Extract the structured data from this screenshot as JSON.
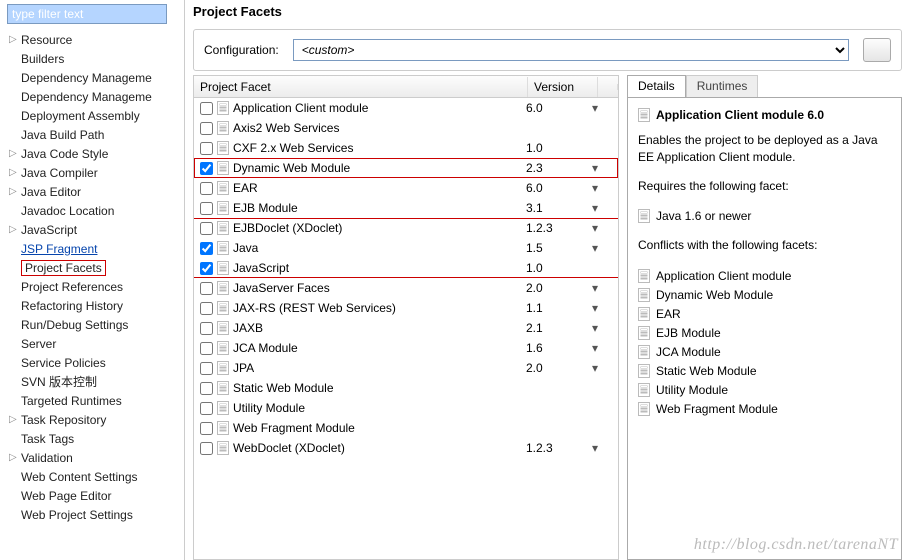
{
  "sidebar": {
    "filter_placeholder": "type filter text",
    "items": [
      {
        "label": "Resource",
        "arrow": "▷"
      },
      {
        "label": "Builders",
        "arrow": ""
      },
      {
        "label": "Dependency Manageme",
        "arrow": ""
      },
      {
        "label": "Dependency Manageme",
        "arrow": ""
      },
      {
        "label": "Deployment Assembly",
        "arrow": ""
      },
      {
        "label": "Java Build Path",
        "arrow": ""
      },
      {
        "label": "Java Code Style",
        "arrow": "▷"
      },
      {
        "label": "Java Compiler",
        "arrow": "▷"
      },
      {
        "label": "Java Editor",
        "arrow": "▷"
      },
      {
        "label": "Javadoc Location",
        "arrow": ""
      },
      {
        "label": "JavaScript",
        "arrow": "▷"
      },
      {
        "label": "JSP Fragment",
        "arrow": "",
        "link": true
      },
      {
        "label": "Project Facets",
        "arrow": "",
        "selected": true
      },
      {
        "label": "Project References",
        "arrow": ""
      },
      {
        "label": "Refactoring History",
        "arrow": ""
      },
      {
        "label": "Run/Debug Settings",
        "arrow": ""
      },
      {
        "label": "Server",
        "arrow": ""
      },
      {
        "label": "Service Policies",
        "arrow": ""
      },
      {
        "label": "SVN 版本控制",
        "arrow": ""
      },
      {
        "label": "Targeted Runtimes",
        "arrow": ""
      },
      {
        "label": "Task Repository",
        "arrow": "▷"
      },
      {
        "label": "Task Tags",
        "arrow": ""
      },
      {
        "label": "Validation",
        "arrow": "▷"
      },
      {
        "label": "Web Content Settings",
        "arrow": ""
      },
      {
        "label": "Web Page Editor",
        "arrow": ""
      },
      {
        "label": "Web Project Settings",
        "arrow": ""
      }
    ]
  },
  "main": {
    "title": "Project Facets",
    "config_label": "Configuration:",
    "config_value": "<custom>"
  },
  "table": {
    "col1": "Project Facet",
    "col2": "Version",
    "rows": [
      {
        "name": "Application Client module",
        "ver": "6.0",
        "drop": true,
        "chk": false
      },
      {
        "name": "Axis2 Web Services",
        "ver": "",
        "drop": false,
        "chk": false
      },
      {
        "name": "CXF 2.x Web Services",
        "ver": "1.0",
        "drop": false,
        "chk": false
      },
      {
        "name": "Dynamic Web Module",
        "ver": "2.3",
        "drop": true,
        "chk": true,
        "redbox": true
      },
      {
        "name": "EAR",
        "ver": "6.0",
        "drop": true,
        "chk": false
      },
      {
        "name": "EJB Module",
        "ver": "3.1",
        "drop": true,
        "chk": false
      },
      {
        "name": "EJBDoclet (XDoclet)",
        "ver": "1.2.3",
        "drop": true,
        "chk": false,
        "septop": true
      },
      {
        "name": "Java",
        "ver": "1.5",
        "drop": true,
        "chk": true
      },
      {
        "name": "JavaScript",
        "ver": "1.0",
        "drop": false,
        "chk": true,
        "sepbot": true
      },
      {
        "name": "JavaServer Faces",
        "ver": "2.0",
        "drop": true,
        "chk": false
      },
      {
        "name": "JAX-RS (REST Web Services)",
        "ver": "1.1",
        "drop": true,
        "chk": false
      },
      {
        "name": "JAXB",
        "ver": "2.1",
        "drop": true,
        "chk": false
      },
      {
        "name": "JCA Module",
        "ver": "1.6",
        "drop": true,
        "chk": false
      },
      {
        "name": "JPA",
        "ver": "2.0",
        "drop": true,
        "chk": false
      },
      {
        "name": "Static Web Module",
        "ver": "",
        "drop": false,
        "chk": false
      },
      {
        "name": "Utility Module",
        "ver": "",
        "drop": false,
        "chk": false
      },
      {
        "name": "Web Fragment Module",
        "ver": "",
        "drop": false,
        "chk": false
      },
      {
        "name": "WebDoclet (XDoclet)",
        "ver": "1.2.3",
        "drop": true,
        "chk": false
      }
    ]
  },
  "details": {
    "tabs": {
      "active": "Details",
      "inactive": "Runtimes"
    },
    "heading": "Application Client module 6.0",
    "desc": "Enables the project to be deployed as a Java EE Application Client module.",
    "requires_label": "Requires the following facet:",
    "requires": [
      {
        "label": "Java 1.6 or newer"
      }
    ],
    "conflicts_label": "Conflicts with the following facets:",
    "conflicts": [
      {
        "label": "Application Client module"
      },
      {
        "label": "Dynamic Web Module"
      },
      {
        "label": "EAR"
      },
      {
        "label": "EJB Module"
      },
      {
        "label": "JCA Module"
      },
      {
        "label": "Static Web Module"
      },
      {
        "label": "Utility Module"
      },
      {
        "label": "Web Fragment Module"
      }
    ]
  },
  "watermark": "http://blog.csdn.net/tarenaNT"
}
